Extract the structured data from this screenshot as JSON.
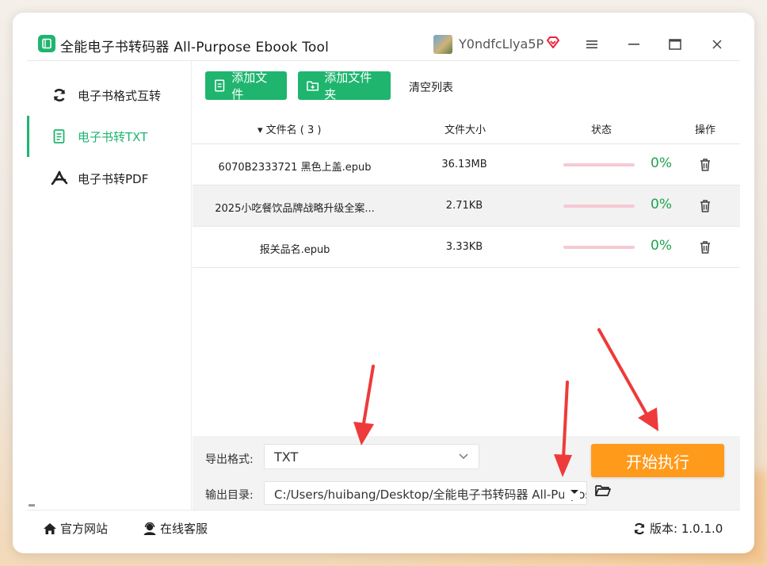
{
  "app": {
    "title": "全能电子书转码器 All-Purpose Ebook Tool",
    "logo_icon": "book-icon",
    "username": "Y0ndfcLlya5P",
    "brand_color": "#1fb56f"
  },
  "window_controls": {
    "menu_icon": "hamburger-icon",
    "minimize_icon": "minimize-icon",
    "maximize_icon": "maximize-icon",
    "close_icon": "close-icon"
  },
  "sidebar": {
    "items": [
      {
        "label": "电子书格式互转",
        "icon": "refresh-icon",
        "active": false
      },
      {
        "label": "电子书转TXT",
        "icon": "document-icon",
        "active": true
      },
      {
        "label": "电子书转PDF",
        "icon": "pdf-icon",
        "active": false
      }
    ]
  },
  "toolbar": {
    "add_file_label": "添加文件",
    "add_folder_label": "添加文件夹",
    "clear_list_label": "清空列表"
  },
  "table": {
    "headers": {
      "name": "▾ 文件名 ( 3 )",
      "size": "文件大小",
      "status": "状态",
      "action": "操作"
    },
    "rows": [
      {
        "name": "6070B2333721 黑色上盖.epub",
        "size": "36.13MB",
        "progress": 0,
        "percent": "0%"
      },
      {
        "name": "2025小吃餐饮品牌战略升级全案...",
        "size": "2.71KB",
        "progress": 0,
        "percent": "0%"
      },
      {
        "name": "报关品名.epub",
        "size": "3.33KB",
        "progress": 0,
        "percent": "0%"
      }
    ]
  },
  "settings": {
    "format_label": "导出格式:",
    "format_value": "TXT",
    "dir_label": "输出目录:",
    "dir_value": "C:/Users/huibang/Desktop/全能电子书转码器 All-Purpose Ebook Tool",
    "start_label": "开始执行",
    "start_color": "#ff9a1a"
  },
  "footer": {
    "site_label": "官方网站",
    "service_label": "在线客服",
    "version_label": "版本: 1.0.1.0"
  }
}
